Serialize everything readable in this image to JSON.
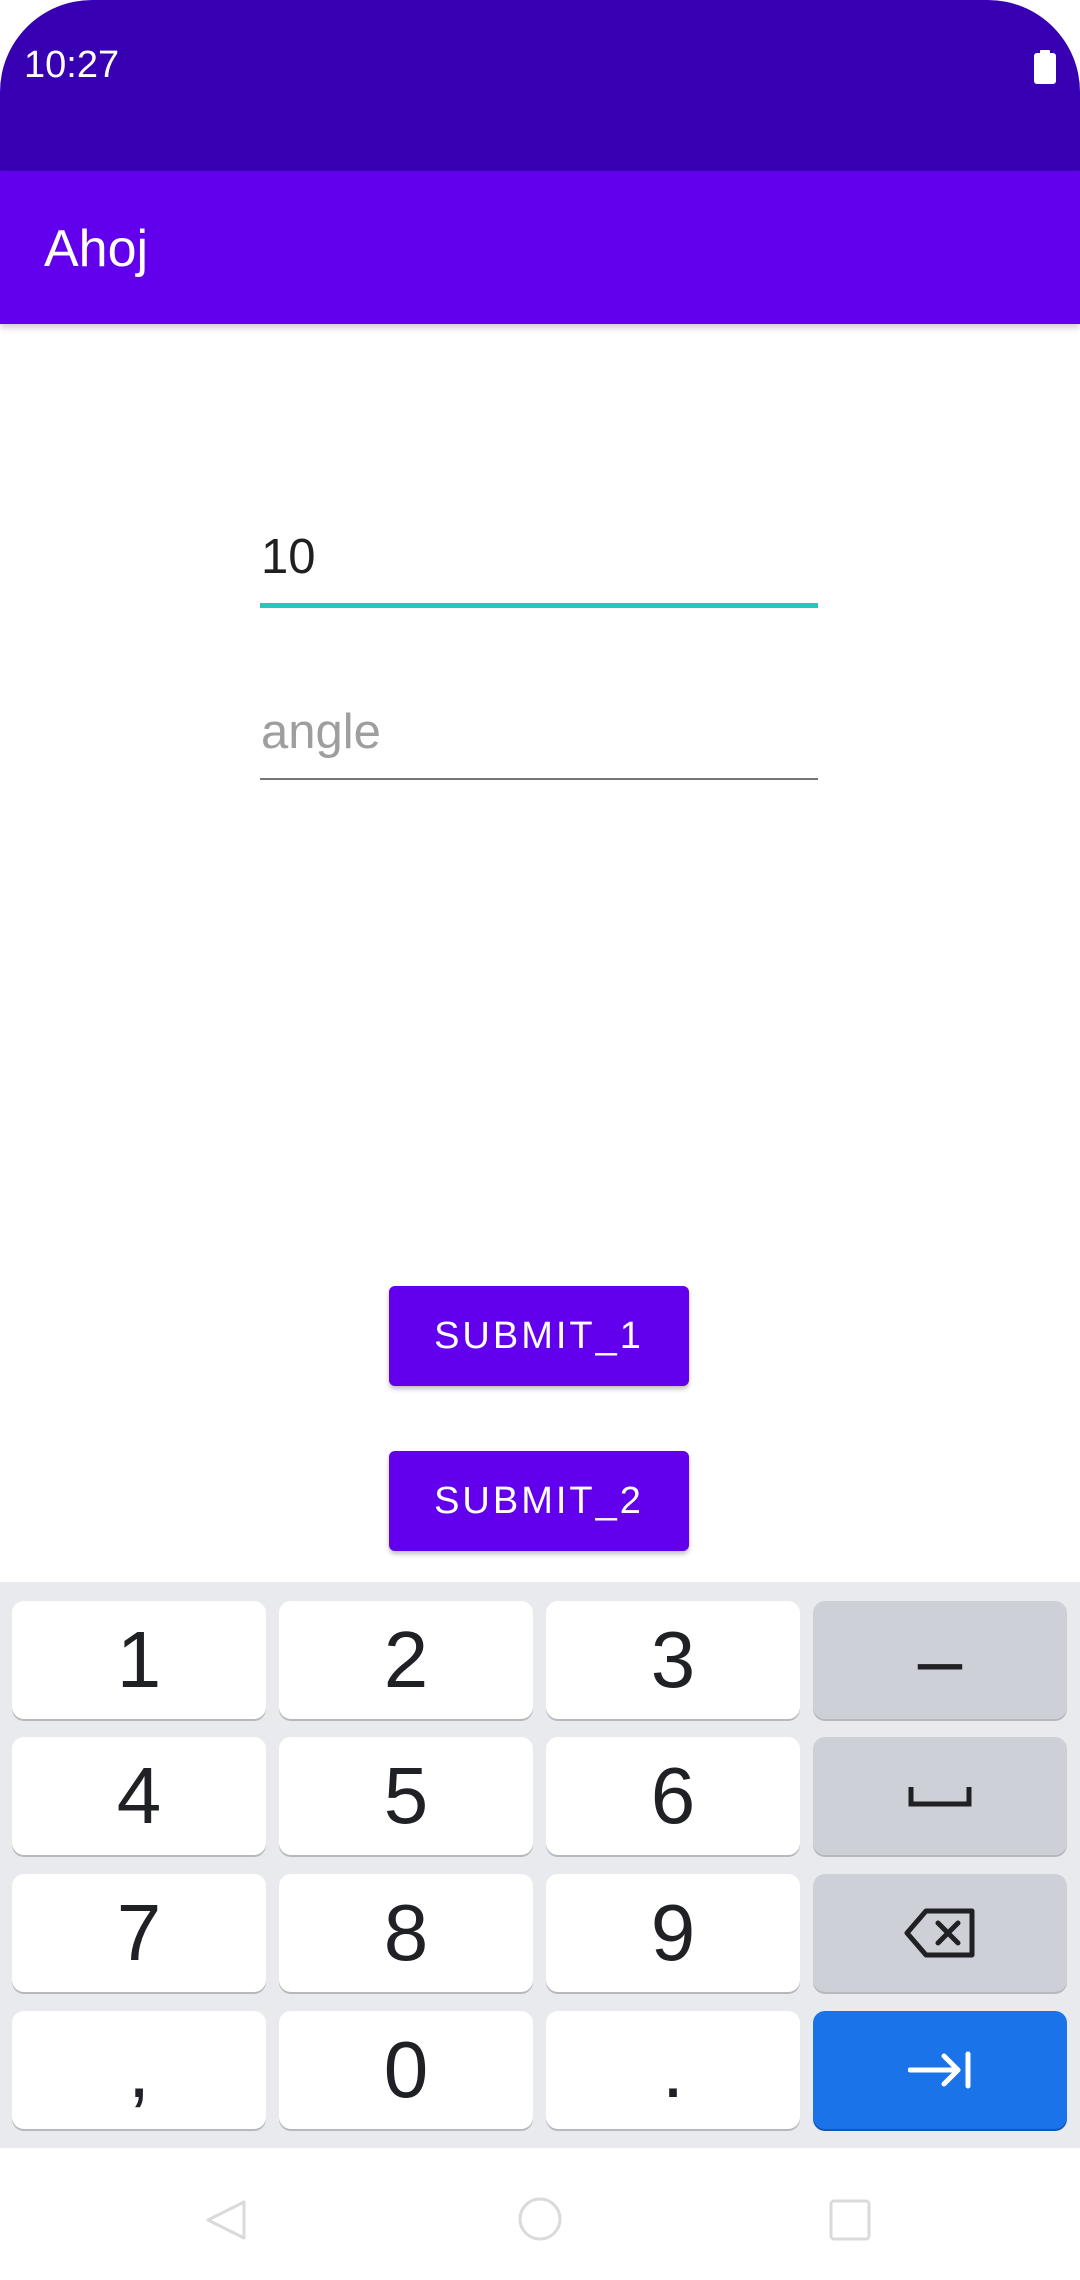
{
  "status_bar": {
    "time": "10:27",
    "icons": [
      "battery-icon"
    ],
    "color": "#3700b3"
  },
  "app_bar": {
    "title": "Ahoj",
    "color": "#6200ee"
  },
  "form": {
    "value_field": {
      "value": "10",
      "focused": true
    },
    "angle_field": {
      "value": "",
      "placeholder": "angle"
    },
    "submit_1_label": "SUBMIT_1",
    "submit_2_label": "SUBMIT_2",
    "accent_color": "#26c6bf"
  },
  "keyboard": {
    "keys": [
      [
        "1",
        "2",
        "3",
        "–"
      ],
      [
        "4",
        "5",
        "6",
        "space-icon"
      ],
      [
        "7",
        "8",
        "9",
        "backspace-icon"
      ],
      [
        ",",
        "0",
        ".",
        "tab-arrow-icon"
      ]
    ],
    "action_color": "#1a73e8"
  },
  "nav_bar": {
    "icons": [
      "back-icon",
      "home-icon",
      "recents-icon"
    ]
  }
}
